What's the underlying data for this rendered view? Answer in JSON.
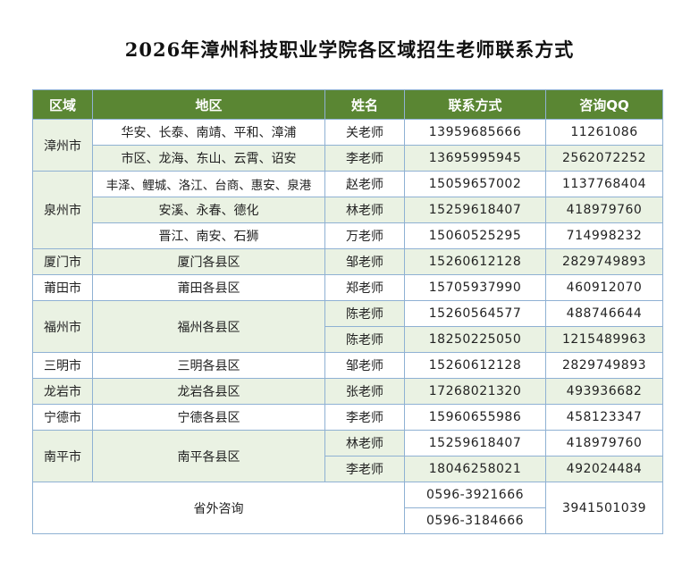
{
  "title": "2026年漳州科技职业学院各区域招生老师联系方式",
  "headers": [
    "区域",
    "地区",
    "姓名",
    "联系方式",
    "咨询QQ"
  ],
  "rows": [
    {
      "region": "漳州市",
      "area": "华安、长泰、南靖、平和、漳浦",
      "name": "关老师",
      "phone": "13959685666",
      "qq": "11261086"
    },
    {
      "area": "市区、龙海、东山、云霄、诏安",
      "name": "李老师",
      "phone": "13695995945",
      "qq": "2562072252"
    },
    {
      "region": "泉州市",
      "area": "丰泽、鲤城、洛江、台商、惠安、泉港",
      "name": "赵老师",
      "phone": "15059657002",
      "qq": "1137768404"
    },
    {
      "area": "安溪、永春、德化",
      "name": "林老师",
      "phone": "15259618407",
      "qq": "418979760"
    },
    {
      "area": "晋江、南安、石狮",
      "name": "万老师",
      "phone": "15060525295",
      "qq": "714998232"
    },
    {
      "region": "厦门市",
      "area": "厦门各县区",
      "name": "邹老师",
      "phone": "15260612128",
      "qq": "2829749893"
    },
    {
      "region": "莆田市",
      "area": "莆田各县区",
      "name": "郑老师",
      "phone": "15705937990",
      "qq": "460912070"
    },
    {
      "region": "福州市",
      "area": "福州各县区",
      "name": "陈老师",
      "phone": "15260564577",
      "qq": "488746644"
    },
    {
      "name": "陈老师",
      "phone": "18250225050",
      "qq": "1215489963"
    },
    {
      "region": "三明市",
      "area": "三明各县区",
      "name": "邹老师",
      "phone": "15260612128",
      "qq": "2829749893"
    },
    {
      "region": "龙岩市",
      "area": "龙岩各县区",
      "name": "张老师",
      "phone": "17268021320",
      "qq": "493936682"
    },
    {
      "region": "宁德市",
      "area": "宁德各县区",
      "name": "李老师",
      "phone": "15960655986",
      "qq": "458123347"
    },
    {
      "region": "南平市",
      "area": "南平各县区",
      "name": "林老师",
      "phone": "15259618407",
      "qq": "418979760"
    },
    {
      "name": "李老师",
      "phone": "18046258021",
      "qq": "492024484"
    }
  ],
  "footer": {
    "label": "省外咨询",
    "phones": [
      "0596-3921666",
      "0596-3184666"
    ],
    "qq": "3941501039"
  }
}
